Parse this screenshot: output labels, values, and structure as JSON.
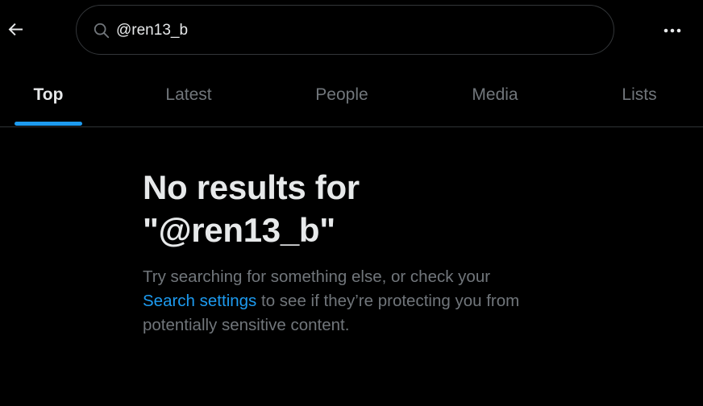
{
  "header": {
    "back_icon": "arrow-left-icon",
    "search": {
      "icon": "search-icon",
      "value": "@ren13_b",
      "placeholder": ""
    },
    "more_icon": "more-horizontal-icon"
  },
  "tabs": [
    {
      "label": "Top",
      "active": true
    },
    {
      "label": "Latest",
      "active": false
    },
    {
      "label": "People",
      "active": false
    },
    {
      "label": "Media",
      "active": false
    },
    {
      "label": "Lists",
      "active": false
    }
  ],
  "empty_state": {
    "title_line1": "No results for",
    "title_line2": "\"@ren13_b\"",
    "description_before": "Try searching for something else, or check your",
    "link_text": "Search settings",
    "description_after": " to see if they’re protecting you from potentially sensitive content."
  },
  "colors": {
    "background": "#000000",
    "primary_text": "#e7e9ea",
    "secondary_text": "#71767b",
    "accent": "#1d9bf0",
    "border": "#2f3336"
  }
}
